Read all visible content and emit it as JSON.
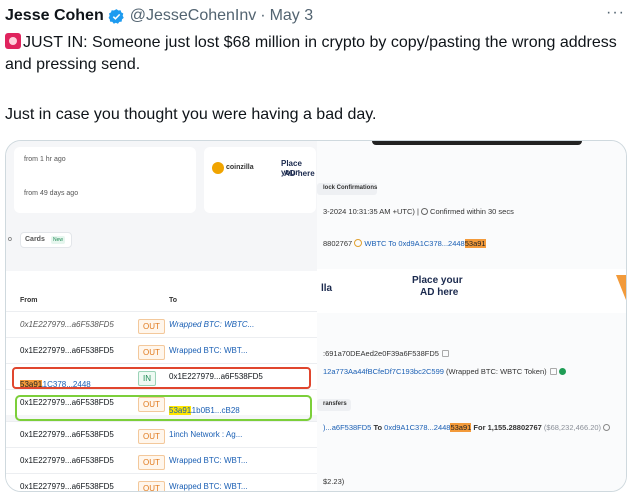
{
  "tweet": {
    "author_name": "Jesse Cohen",
    "handle": "@JesseCohenInv",
    "separator": "·",
    "date": "May 3",
    "more_label": "···",
    "text_line1": "JUST IN: Someone just lost $68 million in crypto by copy/pasting the wrong address and pressing send.",
    "text_line2": "Just in case you thought you were having a bad day."
  },
  "screenshot_left": {
    "card1_time1": "from 1 hr ago",
    "card1_time2": "from 49 days ago",
    "coinzilla": "coinzilla",
    "place_ad": "Place your",
    "ad_here": "AD here",
    "tab_prev": "o",
    "tab_cards": "Cards",
    "tab_new": "New",
    "col_from": "From",
    "col_to": "To",
    "rows": [
      {
        "from": "0x1E227979...a6F538FD5",
        "dir": "OUT",
        "to": "Wrapped BTC: WBTC..."
      },
      {
        "from": "0x1E227979...a6F538FD5",
        "dir": "OUT",
        "to": "Wrapped BTC: WBT..."
      },
      {
        "from_a": "0xd9A1C378...2448",
        "from_b": "53a91",
        "dir": "IN",
        "to": "0x1E227979...a6F538FD5"
      },
      {
        "from": "0x1E227979...a6F538FD5",
        "dir": "OUT",
        "to_a": "0xd9A1b0B1...cB28",
        "to_b": "53a91"
      },
      {
        "from": "0x1E227979...a6F538FD5",
        "dir": "OUT",
        "to": "1inch Network : Ag..."
      },
      {
        "from": "0x1E227979...a6F538FD5",
        "dir": "OUT",
        "to": "Wrapped BTC: WBT..."
      },
      {
        "from": "0x1E227979...a6F538FD5",
        "dir": "OUT",
        "to": "Wrapped BTC: WBT..."
      }
    ]
  },
  "screenshot_right": {
    "block_conf": "lock Confirmations",
    "timestamp": "3-2024 10:31:35 AM +UTC) | ",
    "confirmed": "Confirmed within 30 secs",
    "amount_line_a": "8802767",
    "amount_line_b": "WBTC To 0xd9A1C378...2448",
    "amount_line_hl": "53a91",
    "ad_left": "lla",
    "place_your": "Place your",
    "ad_here": "AD here",
    "addr1": ":691a70DEAed2e0F39a6F538FD5",
    "addr2": "12a773Aa44fBCfeDf7C193bc2C599",
    "addr2_label": "(Wrapped BTC: WBTC Token)",
    "transfers": "ransfers",
    "transfer_a": ")...a6F538FD5",
    "transfer_to": "To",
    "transfer_addr": "0xd9A1C378...2448",
    "transfer_hl": "53a91",
    "transfer_for": "For 1,155.28802767",
    "transfer_usd": "($68,232,466.20)",
    "bottom": "$2.23)"
  }
}
